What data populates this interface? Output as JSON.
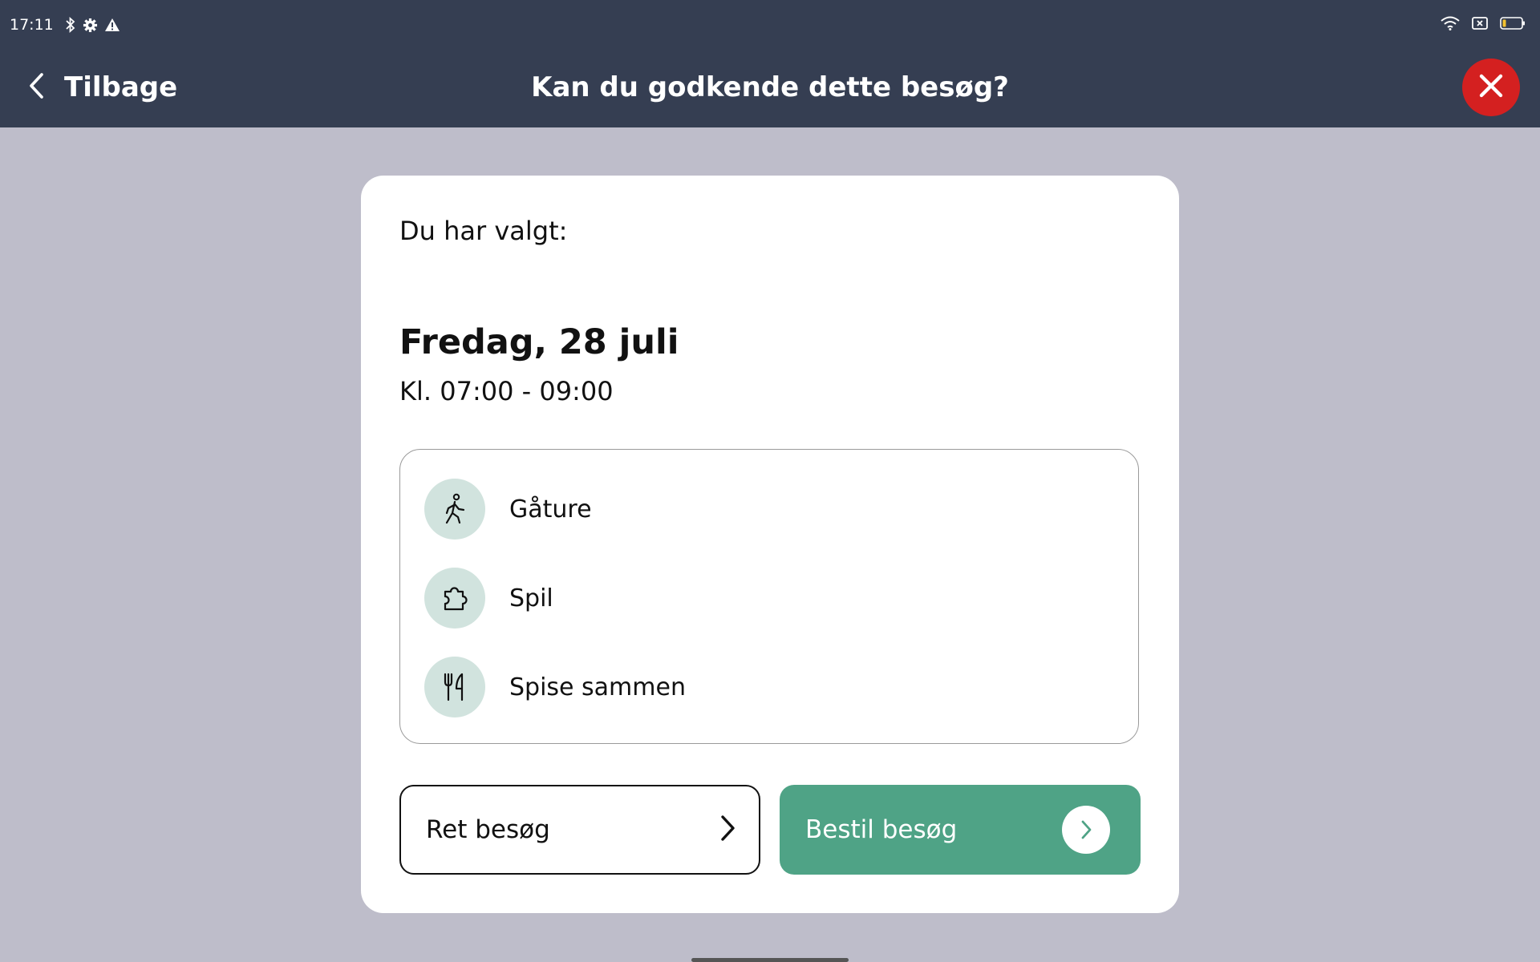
{
  "status_bar": {
    "time": "17:11",
    "left_icons": [
      "bluetooth-icon",
      "settings-icon",
      "warning-icon"
    ],
    "right_icons": [
      "wifi-icon",
      "sim-icon",
      "battery-icon"
    ]
  },
  "header": {
    "back_label": "Tilbage",
    "title": "Kan du godkende dette besøg?",
    "close_icon": "close-icon",
    "close_color": "#d42020",
    "background": "#353e52"
  },
  "card": {
    "chosen_label": "Du har valgt:",
    "date": "Fredag, 28 juli",
    "time_range": "Kl. 07:00 - 09:00",
    "activities": [
      {
        "label": "Gåture",
        "icon": "walking-icon"
      },
      {
        "label": "Spil",
        "icon": "puzzle-icon"
      },
      {
        "label": "Spise sammen",
        "icon": "fork-knife-icon"
      }
    ]
  },
  "actions": {
    "edit_label": "Ret besøg",
    "order_label": "Bestil besøg",
    "accent_color": "#4fa386"
  }
}
